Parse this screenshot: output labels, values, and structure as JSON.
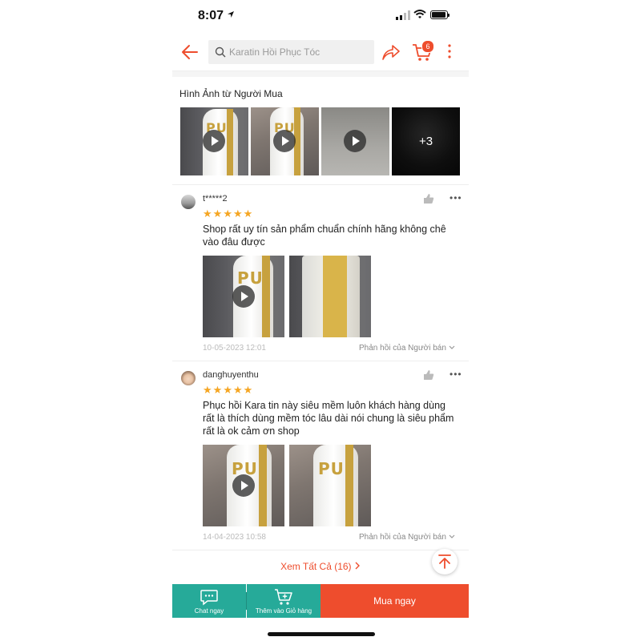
{
  "status_bar": {
    "time": "8:07"
  },
  "header": {
    "search_placeholder": "Karatin Hồi Phục Tóc",
    "cart_count": "6"
  },
  "buyer_images": {
    "title": "Hình Ảnh từ Người Mua",
    "more_count": "+3"
  },
  "reviews": [
    {
      "name": "t*****2",
      "stars": 5,
      "text": "Shop rất uy tín sản phẩm chuẩn chính hãng không chê vào đâu được",
      "date": "10-05-2023 12:01",
      "reply": "Phản hồi của Người bán"
    },
    {
      "name": "danghuyenthu",
      "stars": 5,
      "text": "Phục hồi Kara tin này siêu mềm luôn khách hàng dùng rất là thích dùng mềm tóc lâu dài nói chung là siêu phẩm rất là ok cảm ơn shop",
      "date": "14-04-2023 10:58",
      "reply": "Phản hồi của Người bán"
    }
  ],
  "see_all": "Xem Tất Cả (16)",
  "bottom_bar": {
    "chat_label": "Chat ngay",
    "cart_label": "Thêm vào Giỏ hàng",
    "buy_label": "Mua ngay"
  },
  "colors": {
    "brand": "#ee4d2d",
    "teal": "#26aa99",
    "star": "#f5a623"
  }
}
